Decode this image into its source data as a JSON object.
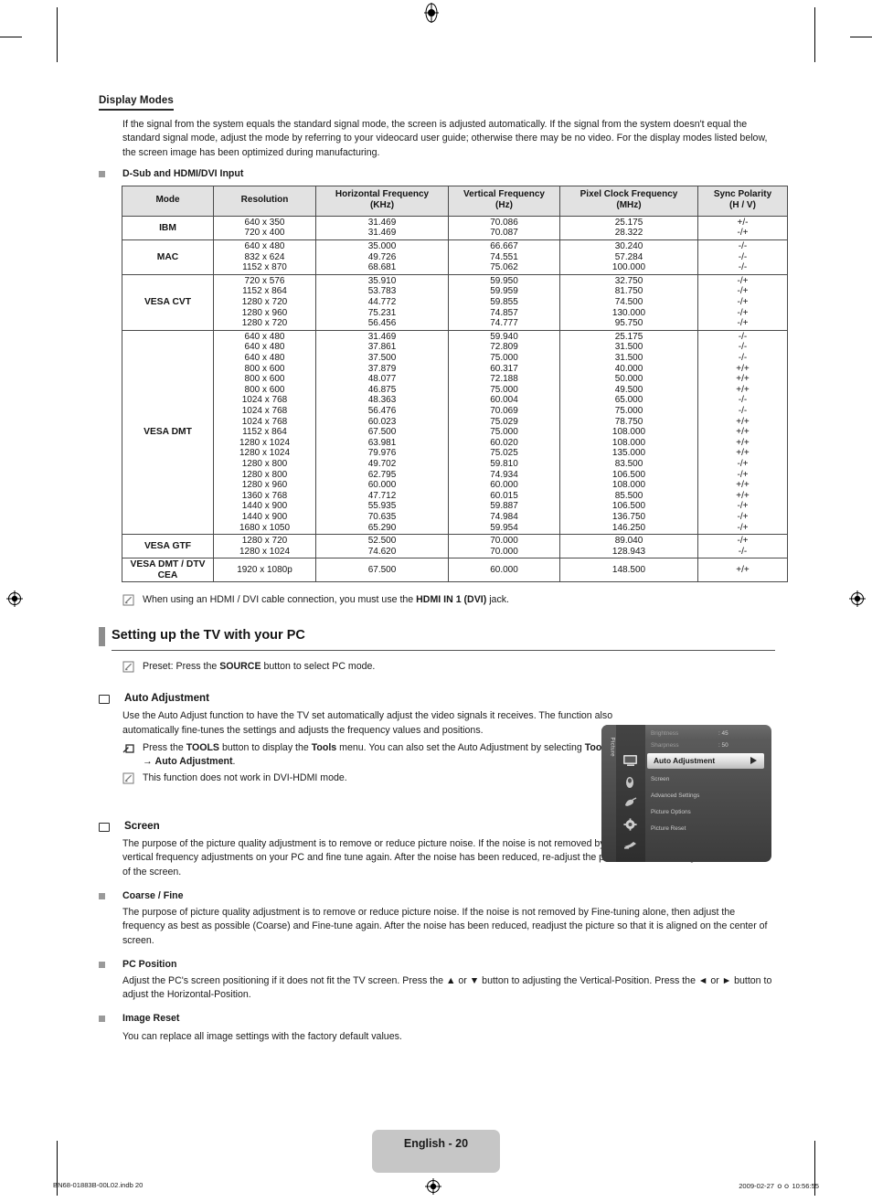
{
  "document": {
    "section_heading": "Display Modes",
    "intro": "If the signal from the system equals the standard signal mode, the screen is adjusted automatically. If the signal from the system doesn't equal the standard signal mode, adjust the mode by referring to your videocard user guide; otherwise there may be no video. For the display modes listed below, the screen image has been optimized during manufacturing.",
    "table_caption": "D-Sub and HDMI/DVI Input"
  },
  "table": {
    "headers": [
      "Mode",
      "Resolution",
      "Horizontal Frequency\n(KHz)",
      "Vertical Frequency\n(Hz)",
      "Pixel Clock Frequency\n(MHz)",
      "Sync Polarity\n(H / V)"
    ],
    "headers_parts": [
      {
        "line1": "Mode",
        "line2": ""
      },
      {
        "line1": "Resolution",
        "line2": ""
      },
      {
        "line1": "Horizontal Frequency",
        "line2": "(KHz)"
      },
      {
        "line1": "Vertical Frequency",
        "line2": "(Hz)"
      },
      {
        "line1": "Pixel Clock Frequency",
        "line2": "(MHz)"
      },
      {
        "line1": "Sync Polarity",
        "line2": "(H / V)"
      }
    ],
    "groups": [
      {
        "mode": "IBM",
        "rows": [
          {
            "resolution": "640 x 350",
            "hfreq": "31.469",
            "vfreq": "70.086",
            "pclock": "25.175",
            "sync": "+/-"
          },
          {
            "resolution": "720 x 400",
            "hfreq": "31.469",
            "vfreq": "70.087",
            "pclock": "28.322",
            "sync": "-/+"
          }
        ]
      },
      {
        "mode": "MAC",
        "rows": [
          {
            "resolution": "640 x 480",
            "hfreq": "35.000",
            "vfreq": "66.667",
            "pclock": "30.240",
            "sync": "-/-"
          },
          {
            "resolution": "832 x 624",
            "hfreq": "49.726",
            "vfreq": "74.551",
            "pclock": "57.284",
            "sync": "-/-"
          },
          {
            "resolution": "1152 x 870",
            "hfreq": "68.681",
            "vfreq": "75.062",
            "pclock": "100.000",
            "sync": "-/-"
          }
        ]
      },
      {
        "mode": "VESA CVT",
        "rows": [
          {
            "resolution": "720 x 576",
            "hfreq": "35.910",
            "vfreq": "59.950",
            "pclock": "32.750",
            "sync": "-/+"
          },
          {
            "resolution": "1152 x 864",
            "hfreq": "53.783",
            "vfreq": "59.959",
            "pclock": "81.750",
            "sync": "-/+"
          },
          {
            "resolution": "1280 x 720",
            "hfreq": "44.772",
            "vfreq": "59.855",
            "pclock": "74.500",
            "sync": "-/+"
          },
          {
            "resolution": "1280 x 960",
            "hfreq": "75.231",
            "vfreq": "74.857",
            "pclock": "130.000",
            "sync": "-/+"
          },
          {
            "resolution": "1280 x 720",
            "hfreq": "56.456",
            "vfreq": "74.777",
            "pclock": "95.750",
            "sync": "-/+"
          }
        ]
      },
      {
        "mode": "VESA DMT",
        "rows": [
          {
            "resolution": "640 x 480",
            "hfreq": "31.469",
            "vfreq": "59.940",
            "pclock": "25.175",
            "sync": "-/-"
          },
          {
            "resolution": "640 x 480",
            "hfreq": "37.861",
            "vfreq": "72.809",
            "pclock": "31.500",
            "sync": "-/-"
          },
          {
            "resolution": "640 x 480",
            "hfreq": "37.500",
            "vfreq": "75.000",
            "pclock": "31.500",
            "sync": "-/-"
          },
          {
            "resolution": "800 x 600",
            "hfreq": "37.879",
            "vfreq": "60.317",
            "pclock": "40.000",
            "sync": "+/+"
          },
          {
            "resolution": "800 x 600",
            "hfreq": "48.077",
            "vfreq": "72.188",
            "pclock": "50.000",
            "sync": "+/+"
          },
          {
            "resolution": "800 x 600",
            "hfreq": "46.875",
            "vfreq": "75.000",
            "pclock": "49.500",
            "sync": "+/+"
          },
          {
            "resolution": "1024 x 768",
            "hfreq": "48.363",
            "vfreq": "60.004",
            "pclock": "65.000",
            "sync": "-/-"
          },
          {
            "resolution": "1024 x 768",
            "hfreq": "56.476",
            "vfreq": "70.069",
            "pclock": "75.000",
            "sync": "-/-"
          },
          {
            "resolution": "1024 x 768",
            "hfreq": "60.023",
            "vfreq": "75.029",
            "pclock": "78.750",
            "sync": "+/+"
          },
          {
            "resolution": "1152 x 864",
            "hfreq": "67.500",
            "vfreq": "75.000",
            "pclock": "108.000",
            "sync": "+/+"
          },
          {
            "resolution": "1280 x 1024",
            "hfreq": "63.981",
            "vfreq": "60.020",
            "pclock": "108.000",
            "sync": "+/+"
          },
          {
            "resolution": "1280 x 1024",
            "hfreq": "79.976",
            "vfreq": "75.025",
            "pclock": "135.000",
            "sync": "+/+"
          },
          {
            "resolution": "1280 x 800",
            "hfreq": "49.702",
            "vfreq": "59.810",
            "pclock": "83.500",
            "sync": "-/+"
          },
          {
            "resolution": "1280 x 800",
            "hfreq": "62.795",
            "vfreq": "74.934",
            "pclock": "106.500",
            "sync": "-/+"
          },
          {
            "resolution": "1280 x 960",
            "hfreq": "60.000",
            "vfreq": "60.000",
            "pclock": "108.000",
            "sync": "+/+"
          },
          {
            "resolution": "1360 x 768",
            "hfreq": "47.712",
            "vfreq": "60.015",
            "pclock": "85.500",
            "sync": "+/+"
          },
          {
            "resolution": "1440 x 900",
            "hfreq": "55.935",
            "vfreq": "59.887",
            "pclock": "106.500",
            "sync": "-/+"
          },
          {
            "resolution": "1440 x 900",
            "hfreq": "70.635",
            "vfreq": "74.984",
            "pclock": "136.750",
            "sync": "-/+"
          },
          {
            "resolution": "1680 x 1050",
            "hfreq": "65.290",
            "vfreq": "59.954",
            "pclock": "146.250",
            "sync": "-/+"
          }
        ]
      },
      {
        "mode": "VESA GTF",
        "rows": [
          {
            "resolution": "1280 x 720",
            "hfreq": "52.500",
            "vfreq": "70.000",
            "pclock": "89.040",
            "sync": "-/+"
          },
          {
            "resolution": "1280 x 1024",
            "hfreq": "74.620",
            "vfreq": "70.000",
            "pclock": "128.943",
            "sync": "-/-"
          }
        ]
      },
      {
        "mode": "VESA DMT / DTV CEA",
        "mode_line1": "VESA DMT / DTV",
        "mode_line2": "CEA",
        "rows": [
          {
            "resolution": "1920 x 1080p",
            "hfreq": "67.500",
            "vfreq": "60.000",
            "pclock": "148.500",
            "sync": "+/+"
          }
        ]
      }
    ]
  },
  "notes": {
    "hdmi_note_pre": "When using an HDMI / DVI cable connection, you must use the ",
    "hdmi_note_bold": "HDMI IN 1 (DVI)",
    "hdmi_note_post": " jack."
  },
  "setup": {
    "band_title": "Setting up the TV with your PC",
    "preset_pre": "Preset: Press the ",
    "preset_bold": "SOURCE",
    "preset_post": " button to select PC mode."
  },
  "auto_adjustment": {
    "title": "Auto Adjustment",
    "body": "Use the Auto Adjust function to have the TV set automatically adjust the video signals it receives. The function also automatically fine-tunes the settings and adjusts the frequency values and positions.",
    "tools_note_1": "Press the ",
    "tools_note_bold_1": "TOOLS",
    "tools_note_2": " button to display the ",
    "tools_note_bold_2": "Tools",
    "tools_note_3": " menu. You can also set the Auto Adjustment by selecting ",
    "tools_note_bold_3": "Tools",
    "tools_note_4": " → ",
    "tools_note_bold_4": "Auto Adjustment",
    "tools_note_5": ".",
    "dvi_note": "This function does not work in DVI-HDMI mode."
  },
  "tv_menu": {
    "sidebar_label": "Picture",
    "items": [
      {
        "label": "Brightness",
        "value": ": 45",
        "state": "dim"
      },
      {
        "label": "Sharpness",
        "value": ": 50",
        "state": "dim"
      },
      {
        "label": "Auto Adjustment",
        "value": "",
        "state": "selected"
      },
      {
        "label": "Screen",
        "value": "",
        "state": "normal"
      },
      {
        "label": "Advanced Settings",
        "value": "",
        "state": "normal"
      },
      {
        "label": "Picture Options",
        "value": "",
        "state": "normal"
      },
      {
        "label": "Picture Reset",
        "value": "",
        "state": "normal"
      }
    ],
    "icons": [
      "picture-icon",
      "sound-icon",
      "channel-icon",
      "setup-icon",
      "input-icon",
      "support-icon"
    ],
    "highlight_color": "#eeeeee"
  },
  "screen_section": {
    "title": "Screen",
    "body": "The purpose of the picture quality adjustment is to remove or reduce picture noise. If the noise is not removed by fine tuning alone, then make the vertical frequency adjustments on your PC and fine tune again. After the noise has been reduced, re-adjust the picture so that it is aligned on the center of the screen.",
    "subsections": [
      {
        "title": "Coarse / Fine",
        "body": "The purpose of picture quality adjustment is to remove or reduce picture noise. If the noise is not removed by Fine-tuning alone, then adjust the frequency as best as possible (Coarse) and Fine-tune again. After the noise has been reduced, readjust the picture so that it is aligned on the center of screen."
      },
      {
        "title": "PC Position",
        "body": "Adjust the PC's screen positioning if it does not fit the TV screen. Press the ▲ or ▼ button to adjusting the Vertical-Position. Press the ◄ or ► button to adjust the Horizontal-Position."
      },
      {
        "title": "Image Reset",
        "body": "You can replace all image settings with the factory default values."
      }
    ]
  },
  "footer": {
    "page_label": "English - 20",
    "file_name": "BN68-01883B-00L02.indb   20",
    "timestamp": "2009-02-27   ｏｏ 10:56:55"
  }
}
